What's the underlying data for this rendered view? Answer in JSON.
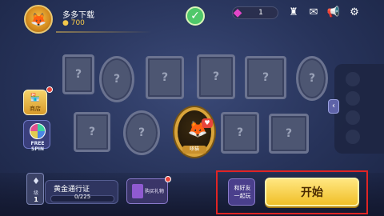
{
  "profile": {
    "name": "多多下载",
    "gold": "700",
    "gold_icon": "coin-icon",
    "avatar_icon": "fox-avatar-icon"
  },
  "top_bar": {
    "check_icon": "checkmark-icon",
    "gems": "1",
    "icons": [
      "gem-icon",
      "trophy-icon",
      "mail-icon",
      "megaphone-icon",
      "gear-icon"
    ]
  },
  "left_buttons": {
    "shop_label": "商店",
    "free_spin_label": "FREE SPIN"
  },
  "featured_character": {
    "label": "哆猫"
  },
  "locked_frames": {
    "placeholder": "?"
  },
  "side_panel": {
    "toggle_icon": "chevron-left-icon"
  },
  "pass": {
    "level_text": "级",
    "level": "1",
    "title": "黄金通行证",
    "progress_text": "0/225",
    "progress_fraction": 0.0
  },
  "gift": {
    "label": "购买礼物"
  },
  "actions": {
    "friends_label": "和好友\n一起玩",
    "start_label": "开始"
  },
  "colors": {
    "accent_gold": "#f0bf28",
    "highlight_red": "#e02424",
    "gem_pink": "#e246c8"
  }
}
